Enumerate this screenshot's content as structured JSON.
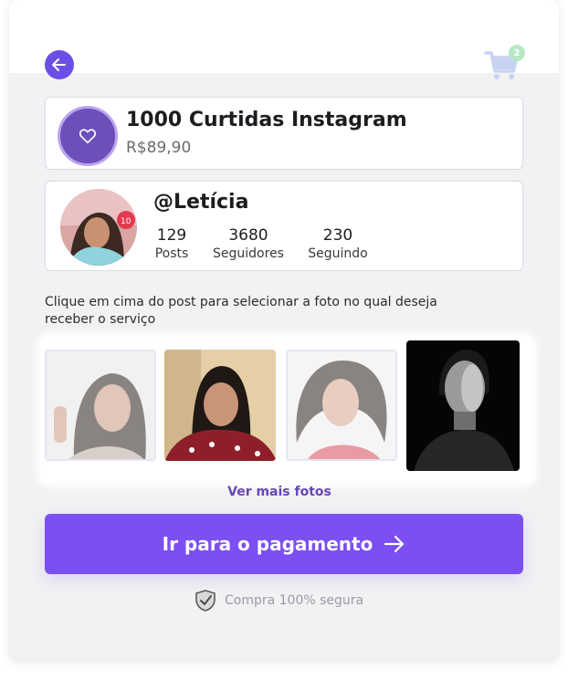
{
  "nav": {
    "cart_count": "2"
  },
  "product": {
    "title": "1000 Curtidas Instagram",
    "price": "R$89,90"
  },
  "profile": {
    "username": "@Letícia",
    "stats": [
      {
        "value": "129",
        "label": "Posts"
      },
      {
        "value": "3680",
        "label": "Seguidores"
      },
      {
        "value": "230",
        "label": "Seguindo"
      }
    ]
  },
  "instructions": "Clique em cima do post para selecionar a foto no qual deseja receber o serviço",
  "photos": {
    "more_label": "Ver mais fotos"
  },
  "checkout": {
    "button_label": "Ir para o pagamento",
    "secure_label": "Compra 100% segura"
  },
  "colors": {
    "accent": "#7b4ff2",
    "back_button": "#6c4ee6",
    "product_avatar": "#6c4fb9",
    "link": "#6a46b7"
  }
}
